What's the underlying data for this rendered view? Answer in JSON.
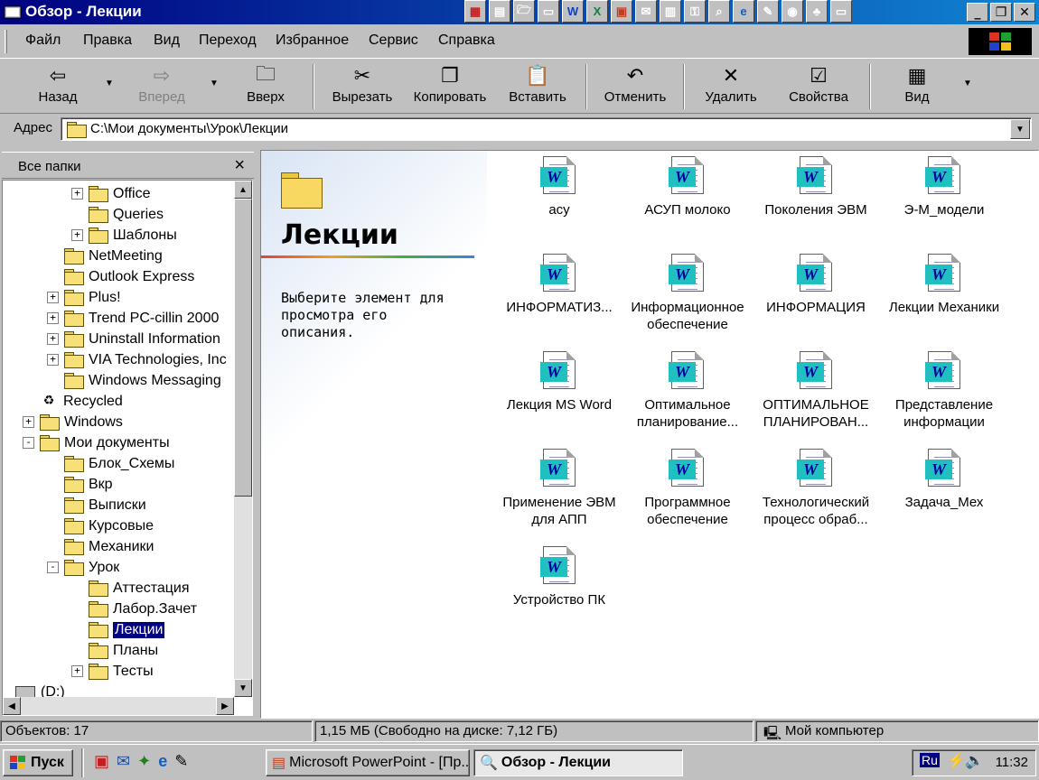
{
  "window": {
    "title": "Обзор - Лекции"
  },
  "quicklaunch": [
    "office-icon",
    "notepad-icon",
    "folder-open-icon",
    "desktop-icon",
    "word-icon",
    "excel-icon",
    "powerpoint-icon",
    "outlook-icon",
    "calendar-icon",
    "key-icon",
    "search-icon",
    "ie-icon",
    "paint-icon",
    "camera-icon",
    "game-icon",
    "monitor-icon"
  ],
  "menu": [
    "Файл",
    "Правка",
    "Вид",
    "Переход",
    "Избранное",
    "Сервис",
    "Справка"
  ],
  "toolbar": {
    "back": "Назад",
    "forward": "Вперед",
    "up": "Вверх",
    "cut": "Вырезать",
    "copy": "Копировать",
    "paste": "Вставить",
    "undo": "Отменить",
    "delete": "Удалить",
    "properties": "Свойства",
    "view": "Вид"
  },
  "address": {
    "label": "Адрес",
    "value": "C:\\Мои документы\\Урок\\Лекции"
  },
  "folders_panel": {
    "title": "Все папки",
    "close": "×",
    "nodes": [
      {
        "label": "Office",
        "expander": "+"
      },
      {
        "label": "Queries",
        "expander": ""
      },
      {
        "label": "Шаблоны",
        "expander": "+"
      },
      {
        "label": "NetMeeting",
        "expander": ""
      },
      {
        "label": "Outlook Express",
        "expander": ""
      },
      {
        "label": "Plus!",
        "expander": "+"
      },
      {
        "label": "Trend PC-cillin 2000",
        "expander": "+"
      },
      {
        "label": "Uninstall Information",
        "expander": "+"
      },
      {
        "label": "VIA Technologies, Inc",
        "expander": "+"
      },
      {
        "label": "Windows Messaging",
        "expander": ""
      },
      {
        "label": "Recycled",
        "expander": ""
      },
      {
        "label": "Windows",
        "expander": "+"
      },
      {
        "label": "Мои документы",
        "expander": "-"
      },
      {
        "label": "Блок_Схемы",
        "expander": ""
      },
      {
        "label": "Вкр",
        "expander": ""
      },
      {
        "label": "Выписки",
        "expander": ""
      },
      {
        "label": "Курсовые",
        "expander": ""
      },
      {
        "label": "Механики",
        "expander": ""
      },
      {
        "label": "Урок",
        "expander": "-"
      },
      {
        "label": "Аттестация",
        "expander": ""
      },
      {
        "label": "Лабор.Зачет",
        "expander": ""
      },
      {
        "label": "Лекции",
        "expander": ""
      },
      {
        "label": "Планы",
        "expander": ""
      },
      {
        "label": "Тесты",
        "expander": "+"
      },
      {
        "label": "(D:)",
        "expander": ""
      }
    ]
  },
  "webview": {
    "title": "Лекции",
    "description": "Выберите элемент для просмотра его описания."
  },
  "files": [
    {
      "line1": "асу",
      "line2": ""
    },
    {
      "line1": "АСУП молоко",
      "line2": ""
    },
    {
      "line1": "Поколения ЭВМ",
      "line2": ""
    },
    {
      "line1": "Э-М_модели",
      "line2": ""
    },
    {
      "line1": "ИНФОРМАТИЗ...",
      "line2": ""
    },
    {
      "line1": "Информационное",
      "line2": "обеспечение"
    },
    {
      "line1": "ИНФОРМАЦИЯ",
      "line2": ""
    },
    {
      "line1": "Лекции Механики",
      "line2": ""
    },
    {
      "line1": "Лекция MS Word",
      "line2": ""
    },
    {
      "line1": "Оптимальное",
      "line2": "планирование..."
    },
    {
      "line1": "ОПТИМАЛЬНОЕ",
      "line2": "ПЛАНИРОВАН..."
    },
    {
      "line1": "Представление",
      "line2": "информации"
    },
    {
      "line1": "Применение ЭВМ",
      "line2": "для АПП"
    },
    {
      "line1": "Программное",
      "line2": "обеспечение"
    },
    {
      "line1": "Технологический",
      "line2": "процесс обраб..."
    },
    {
      "line1": "Задача_Мех",
      "line2": ""
    },
    {
      "line1": "Устройство ПК",
      "line2": ""
    }
  ],
  "status": {
    "objects": "Объектов: 17",
    "size": "1,15 МБ (Свободно на диске: 7,12 ГБ)",
    "location": "Мой компьютер"
  },
  "taskbar": {
    "start": "Пуск",
    "tasks": [
      "Microsoft PowerPoint - [Пр...",
      "Обзор - Лекции"
    ],
    "lang": "Ru",
    "time": "11:32"
  }
}
